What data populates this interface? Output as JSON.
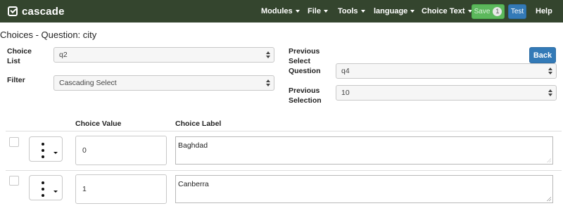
{
  "app": {
    "brand": "cascade"
  },
  "navbar": {
    "menus": [
      {
        "label": "Modules"
      },
      {
        "label": "File"
      },
      {
        "label": "Tools"
      },
      {
        "label": "language"
      },
      {
        "label": "Choice Text"
      }
    ],
    "save_label": "Save",
    "save_count": "1",
    "test_label": "Test",
    "help_label": "Help"
  },
  "page": {
    "title": "Choices - Question: city"
  },
  "form": {
    "choice_list": {
      "label": "Choice List",
      "value": "q2"
    },
    "filter": {
      "label": "Filter",
      "value": "Cascading Select"
    },
    "previous_select_question": {
      "label": "Previous Select Question",
      "value": "q4"
    },
    "previous_selection": {
      "label": "Previous Selection",
      "value": "10"
    },
    "back_label": "Back"
  },
  "table": {
    "columns": {
      "value": "Choice Value",
      "label": "Choice Label"
    },
    "rows": [
      {
        "value": "0",
        "label": "Baghdad"
      },
      {
        "value": "1",
        "label": "Canberra"
      }
    ]
  },
  "colors": {
    "navbar": "#34452e",
    "save": "#5cb85c",
    "primary": "#337ab7"
  },
  "icons": {
    "brand": "check-square-icon",
    "row_menu": "vertical-dots-icon"
  }
}
